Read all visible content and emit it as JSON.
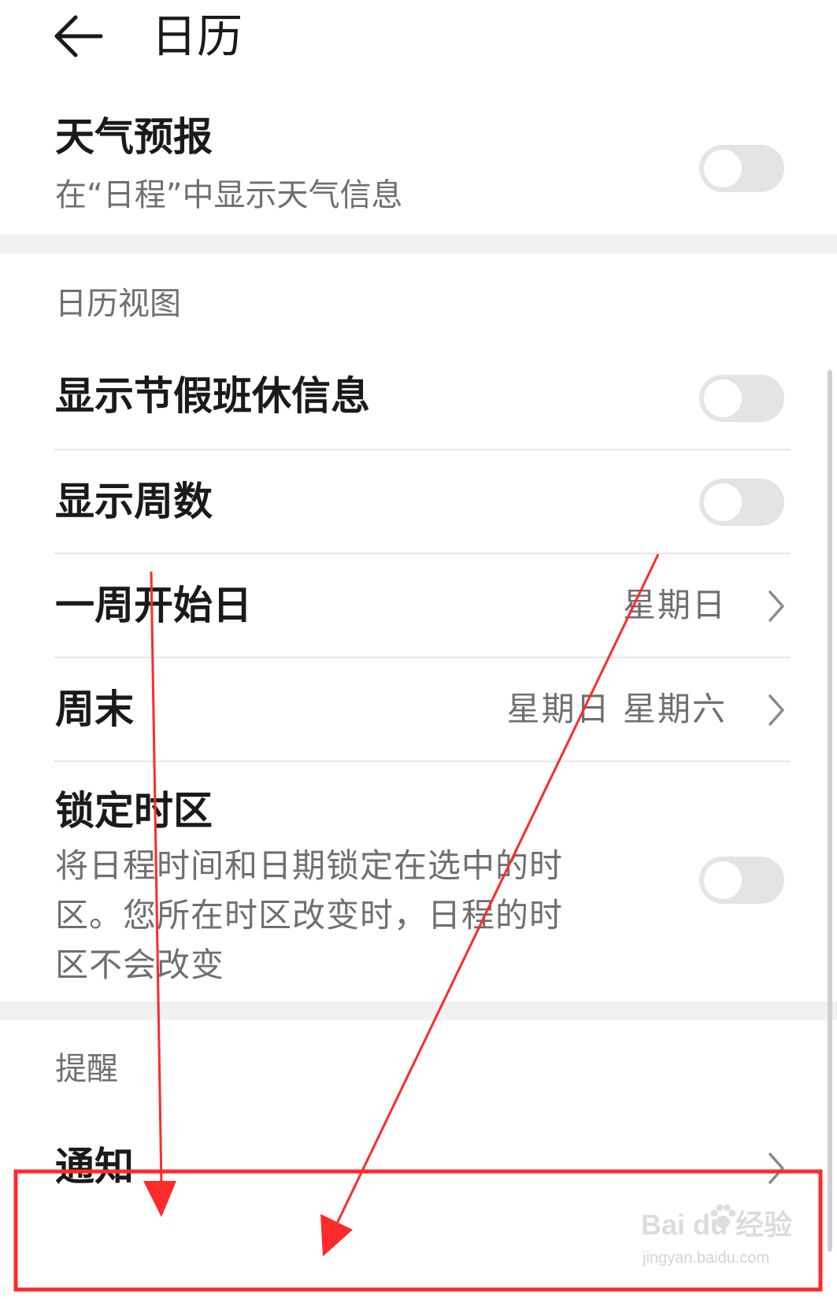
{
  "header": {
    "title": "日历",
    "back_icon": "arrow-left-icon"
  },
  "weather": {
    "title": "天气预报",
    "subtitle": "在“日程”中显示天气信息",
    "toggle_on": false
  },
  "calendar_view": {
    "section_label": "日历视图",
    "show_holidays": {
      "title": "显示节假班休信息",
      "toggle_on": false
    },
    "show_week_numbers": {
      "title": "显示周数",
      "toggle_on": false
    },
    "week_start": {
      "title": "一周开始日",
      "value": "星期日"
    },
    "weekend": {
      "title": "周末",
      "value": "星期日 星期六"
    },
    "lock_timezone": {
      "title": "锁定时区",
      "description_lines": [
        "将日程时间和日期锁定在选中的时",
        "区。您所在时区改变时，日程的时",
        "区不会改变"
      ],
      "toggle_on": false
    }
  },
  "reminders": {
    "section_label": "提醒",
    "notifications": {
      "title": "通知"
    }
  },
  "annotation": {
    "color": "#ff2a2a"
  },
  "watermark": {
    "brand": "Bai  du 经验",
    "url": "jingyan.baidu.com"
  },
  "colors": {
    "text_primary": "#1a1a1a",
    "text_secondary": "#6f6f6f",
    "toggle_off": "#e4e4e4",
    "divider": "#e6e6e6",
    "annotation_red": "#ff2a2a"
  }
}
